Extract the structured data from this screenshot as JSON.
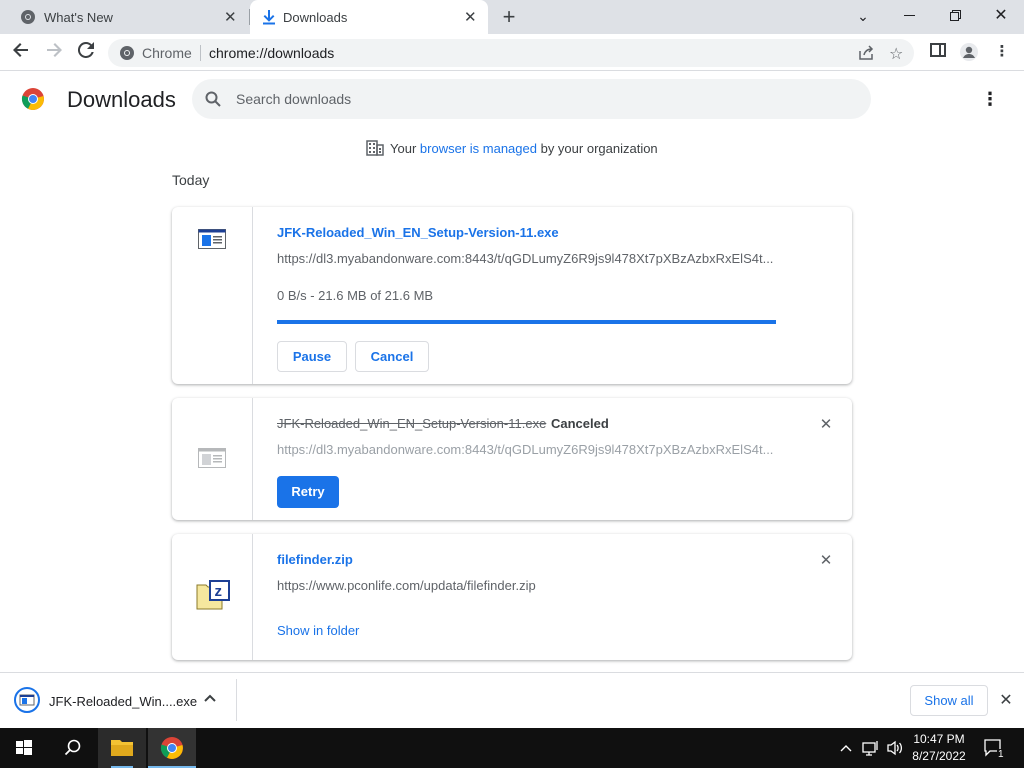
{
  "browser": {
    "tabs": [
      {
        "title": "What's New",
        "icon": "chrome-icon"
      },
      {
        "title": "Downloads",
        "icon": "download-icon"
      }
    ],
    "omnibox": {
      "site": "Chrome",
      "url": "chrome://downloads"
    }
  },
  "header": {
    "title": "Downloads",
    "search_placeholder": "Search downloads"
  },
  "managed": {
    "prefix": "Your",
    "link": "browser is managed",
    "suffix": "by your organization"
  },
  "section_label": "Today",
  "downloads": [
    {
      "filename": "JFK-Reloaded_Win_EN_Setup-Version-11.exe",
      "url": "https://dl3.myabandonware.com:8443/t/qGDLumyZ6R9js9l478Xt7pXBzAzbxRxElS4t...",
      "status": "0 B/s - 21.6 MB of 21.6 MB",
      "progress": 1.0,
      "buttons": [
        "Pause",
        "Cancel"
      ]
    },
    {
      "filename": "JFK-Reloaded_Win_EN_Setup-Version-11.exe",
      "state": "Canceled",
      "url": "https://dl3.myabandonware.com:8443/t/qGDLumyZ6R9js9l478Xt7pXBzAzbxRxElS4t...",
      "button": "Retry"
    },
    {
      "filename": "filefinder.zip",
      "url": "https://www.pconlife.com/updata/filefinder.zip",
      "link": "Show in folder"
    }
  ],
  "shelf": {
    "item_name": "JFK-Reloaded_Win....exe",
    "show_all": "Show all"
  },
  "taskbar": {
    "time": "10:47 PM",
    "date": "8/27/2022",
    "notification_count": "1"
  },
  "colors": {
    "accent": "#1a73e8",
    "tabstrip": "#dee1e6",
    "taskbar": "#101010"
  }
}
